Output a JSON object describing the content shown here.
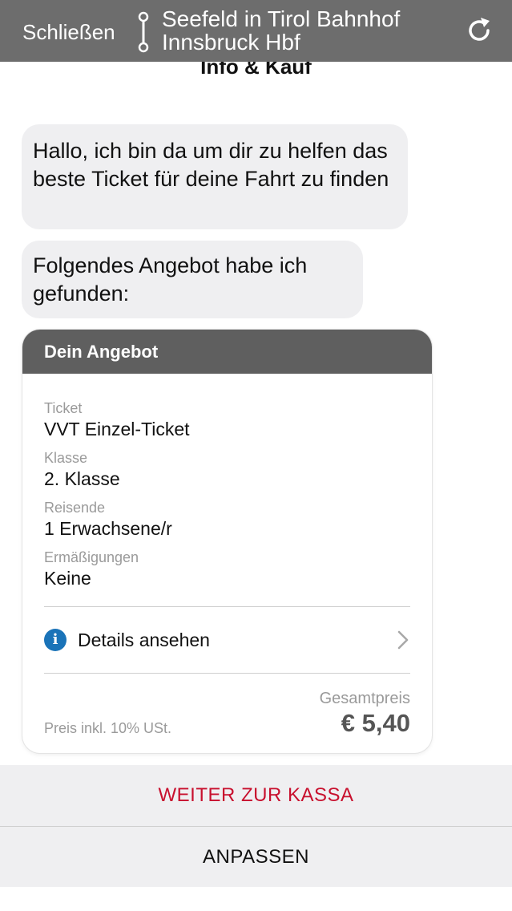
{
  "header": {
    "close_label": "Schließen",
    "route_from": "Seefeld in Tirol Bahnhof",
    "route_to": "Innsbruck Hbf",
    "icons": {
      "route": "route-icon",
      "reload": "reload-icon"
    }
  },
  "page": {
    "subtitle": "Info & Kauf"
  },
  "chat": {
    "messages": [
      "Hallo, ich bin da um dir zu helfen das beste Ticket für deine Fahrt zu finden",
      "Folgendes Angebot habe ich gefunden:"
    ]
  },
  "offer": {
    "title": "Dein Angebot",
    "fields": [
      {
        "label": "Ticket",
        "value": "VVT Einzel-Ticket"
      },
      {
        "label": "Klasse",
        "value": "2. Klasse"
      },
      {
        "label": "Reisende",
        "value": "1 Erwachsene/r"
      },
      {
        "label": "Ermäßigungen",
        "value": "Keine"
      }
    ],
    "details_label": "Details ansehen",
    "vat_note": "Preis inkl. 10% USt.",
    "total_label": "Gesamtpreis",
    "total_price": "€ 5,40"
  },
  "actions": {
    "checkout_label": "WEITER ZUR KASSA",
    "adjust_label": "ANPASSEN"
  },
  "colors": {
    "topbar": "#6d6d6d",
    "card_header": "#5f5f5f",
    "accent_red": "#c8102e",
    "info_blue": "#1a73b8",
    "bubble": "#efeff1"
  }
}
